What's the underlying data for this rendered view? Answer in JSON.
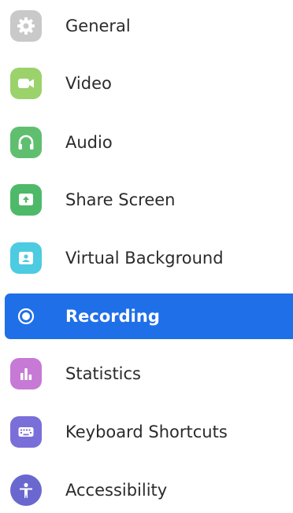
{
  "sidebar": {
    "items": [
      {
        "label": "General",
        "icon": "gear-icon",
        "color": "#c9c9c9"
      },
      {
        "label": "Video",
        "icon": "video-camera-icon",
        "color": "#9bd26c"
      },
      {
        "label": "Audio",
        "icon": "headphones-icon",
        "color": "#5fbf6f"
      },
      {
        "label": "Share Screen",
        "icon": "share-screen-icon",
        "color": "#4fb96a"
      },
      {
        "label": "Virtual Background",
        "icon": "virtual-background-icon",
        "color": "#4dcbe0"
      },
      {
        "label": "Recording",
        "icon": "record-icon",
        "color": "#1f6fe8",
        "active": true
      },
      {
        "label": "Statistics",
        "icon": "statistics-icon",
        "color": "#c779d6"
      },
      {
        "label": "Keyboard Shortcuts",
        "icon": "keyboard-icon",
        "color": "#7a6fd8"
      },
      {
        "label": "Accessibility",
        "icon": "accessibility-icon",
        "color": "#6a68cf"
      }
    ]
  }
}
